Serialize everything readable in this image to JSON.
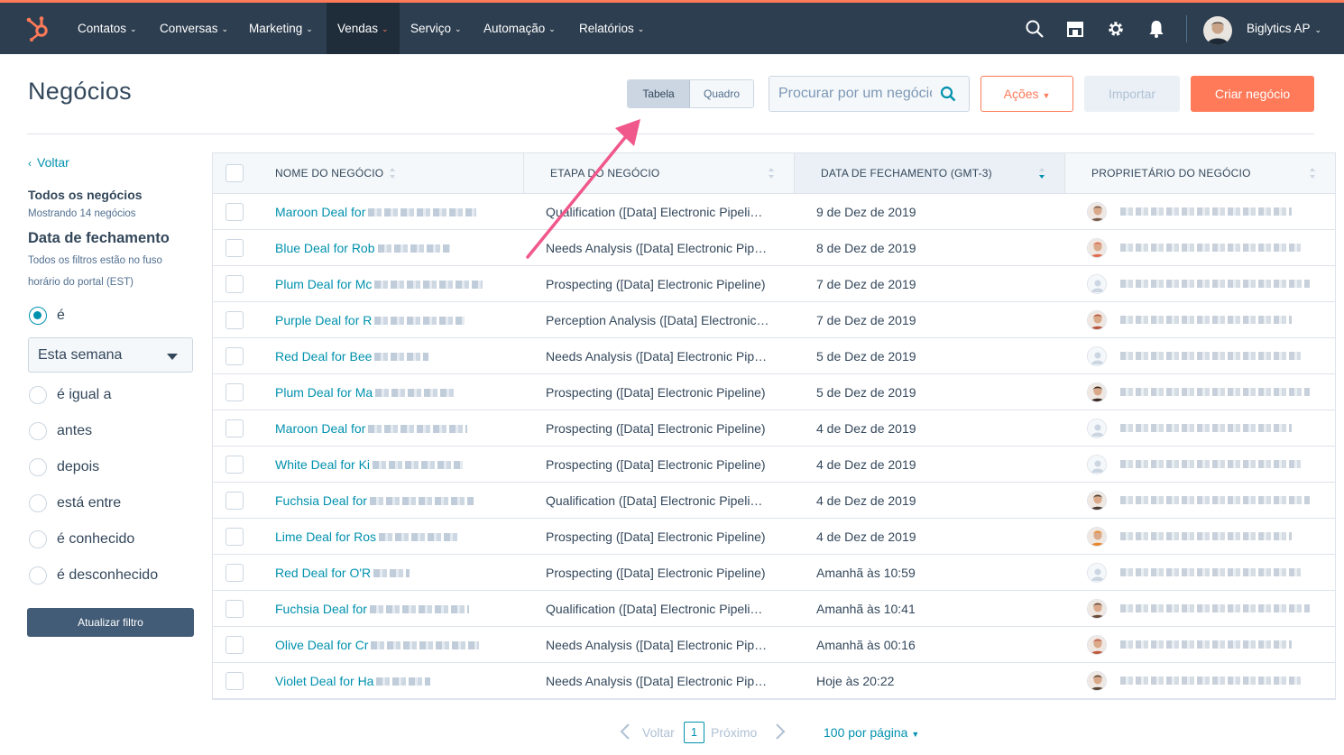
{
  "nav": {
    "items": [
      {
        "label": "Contatos",
        "active": false
      },
      {
        "label": "Conversas",
        "active": false
      },
      {
        "label": "Marketing",
        "active": false
      },
      {
        "label": "Vendas",
        "active": true
      },
      {
        "label": "Serviço",
        "active": false
      },
      {
        "label": "Automação",
        "active": false
      },
      {
        "label": "Relatórios",
        "active": false
      }
    ],
    "account": "Biglytics AP",
    "icons": [
      "search-icon",
      "marketplace-icon",
      "gear-icon",
      "bell-icon"
    ]
  },
  "header": {
    "title": "Negócios",
    "view_table": "Tabela",
    "view_board": "Quadro",
    "search_placeholder": "Procurar por um negócio",
    "actions": "Ações",
    "import": "Importar",
    "create": "Criar negócio"
  },
  "sidebar": {
    "back": "Voltar",
    "all_deals": "Todos os negócios",
    "showing": "Mostrando 14 negócios",
    "filter_title": "Data de fechamento",
    "filter_note": "Todos os filtros estão no fuso horário do portal (EST)",
    "options": [
      {
        "label": "é",
        "checked": true
      },
      {
        "label": "é igual a",
        "checked": false
      },
      {
        "label": "antes",
        "checked": false
      },
      {
        "label": "depois",
        "checked": false
      },
      {
        "label": "está entre",
        "checked": false
      },
      {
        "label": "é conhecido",
        "checked": false
      },
      {
        "label": "é desconhecido",
        "checked": false
      }
    ],
    "select_value": "Esta semana",
    "update_button": "Atualizar filtro"
  },
  "table": {
    "columns": [
      "NOME DO NEGÓCIO",
      "ETAPA DO NEGÓCIO",
      "DATA DE FECHAMENTO (GMT-3)",
      "PROPRIETÁRIO DO NEGÓCIO"
    ],
    "rows": [
      {
        "name": "Maroon Deal for",
        "stage": "Qualification ([Data] Electronic Pipeli…",
        "date": "9 de Dez de 2019",
        "avatar": "#7a5c48"
      },
      {
        "name": "Blue Deal for Rob",
        "stage": "Needs Analysis ([Data] Electronic Pip…",
        "date": "8 de Dez de 2019",
        "avatar": "#e06a4e"
      },
      {
        "name": "Plum Deal for Mc",
        "stage": "Prospecting ([Data] Electronic Pipeline)",
        "date": "7 de Dez de 2019",
        "avatar": ""
      },
      {
        "name": "Purple Deal for R",
        "stage": "Perception Analysis ([Data] Electronic…",
        "date": "7 de Dez de 2019",
        "avatar": "#b5553c"
      },
      {
        "name": "Red Deal for Bee",
        "stage": "Needs Analysis ([Data] Electronic Pip…",
        "date": "5 de Dez de 2019",
        "avatar": ""
      },
      {
        "name": "Plum Deal for Ma",
        "stage": "Prospecting ([Data] Electronic Pipeline)",
        "date": "5 de Dez de 2019",
        "avatar": "#3b2a22"
      },
      {
        "name": "Maroon Deal for",
        "stage": "Prospecting ([Data] Electronic Pipeline)",
        "date": "4 de Dez de 2019",
        "avatar": ""
      },
      {
        "name": "White Deal for Ki",
        "stage": "Prospecting ([Data] Electronic Pipeline)",
        "date": "4 de Dez de 2019",
        "avatar": ""
      },
      {
        "name": "Fuchsia Deal for",
        "stage": "Qualification ([Data] Electronic Pipeli…",
        "date": "4 de Dez de 2019",
        "avatar": "#4a3a30"
      },
      {
        "name": "Lime Deal for Ros",
        "stage": "Prospecting ([Data] Electronic Pipeline)",
        "date": "4 de Dez de 2019",
        "avatar": "#e8862b"
      },
      {
        "name": "Red Deal for O'R",
        "stage": "Prospecting ([Data] Electronic Pipeline)",
        "date": "Amanhã às 10:59",
        "avatar": ""
      },
      {
        "name": "Fuchsia Deal for",
        "stage": "Qualification ([Data] Electronic Pipeli…",
        "date": "Amanhã às 10:41",
        "avatar": "#6b4a3a"
      },
      {
        "name": "Olive Deal for Cr",
        "stage": "Needs Analysis ([Data] Electronic Pip…",
        "date": "Amanhã às 00:16",
        "avatar": "#c0573f"
      },
      {
        "name": "Violet Deal for Ha",
        "stage": "Needs Analysis ([Data] Electronic Pip…",
        "date": "Hoje às 20:22",
        "avatar": "#5b4636"
      }
    ]
  },
  "pagination": {
    "prev": "Voltar",
    "page": "1",
    "next": "Próximo",
    "per_page": "100 por página"
  },
  "colors": {
    "nav_bg": "#2d3e50",
    "accent": "#ff7a59",
    "link": "#0091ae",
    "text": "#33475b"
  }
}
